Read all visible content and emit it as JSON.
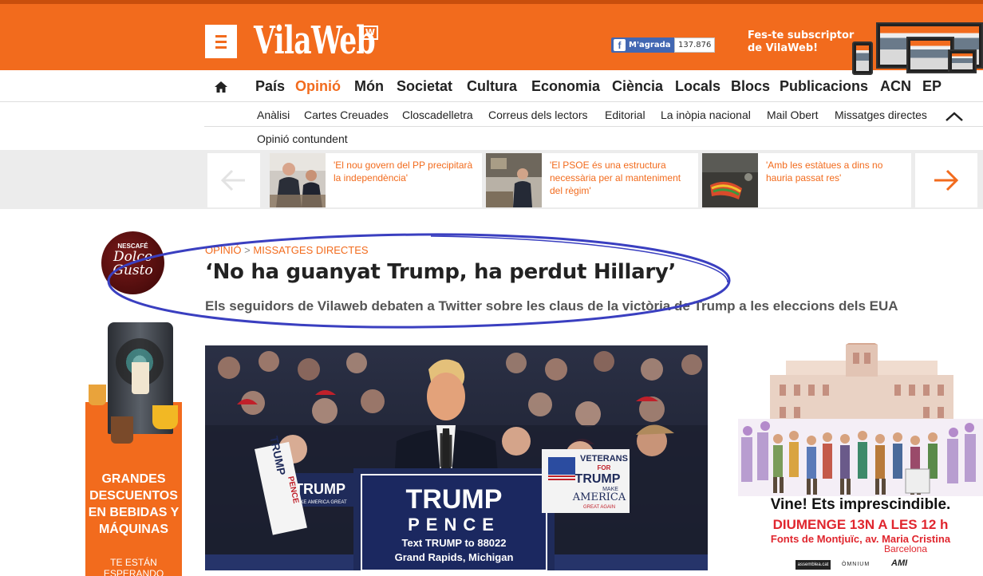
{
  "header": {
    "logo_text": "VilaWeb",
    "logo_badge": "W",
    "fb_like_label": "M'agrada",
    "fb_count": "137.876",
    "subscribe_line1": "Fes-te subscriptor",
    "subscribe_line2": "de VilaWeb!"
  },
  "main_nav": [
    "País",
    "Opinió",
    "Món",
    "Societat",
    "Cultura",
    "Economia",
    "Ciència",
    "Locals",
    "Blocs",
    "Publicacions",
    "ACN",
    "EP"
  ],
  "sub_nav": [
    "Anàlisi",
    "Cartes Creuades",
    "Closcadelletra",
    "Correus dels lectors",
    "Editorial",
    "La inòpia nacional",
    "Mail Obert",
    "Missatges directes",
    "Opinió contundent"
  ],
  "carousel": [
    {
      "text": "'El nou govern del PP precipitarà la independència'"
    },
    {
      "text": "'El PSOE és una estructura necessària per al manteniment del règim'"
    },
    {
      "text": "'Amb les estàtues a dins no hauria passat res'"
    }
  ],
  "article": {
    "breadcrumb_section": "OPINIÓ",
    "breadcrumb_sep": ">",
    "breadcrumb_sub": "MISSATGES DIRECTES",
    "headline": "‘No ha guanyat Trump, ha perdut Hillary’",
    "subtitle": "Els seguidors de Vilaweb debaten a Twitter sobre les claus de la victòria de Trump a les eleccions dels EUA"
  },
  "sponsor": {
    "brand": "NESCAFÉ",
    "name_line1": "Dolce",
    "name_line2": "Gusto"
  },
  "ad_left": {
    "headline": "GRANDES DESCUENTOS EN BEBIDAS Y MÁQUINAS",
    "footer": "TE ESTÁN ESPERANDO"
  },
  "photo": {
    "sign_main_line1": "TRUMP",
    "sign_main_line2": "PENCE",
    "sign_main_line3": "Text TRUMP to 88022",
    "sign_main_line4": "Grand Rapids, Michigan",
    "sign_left_word": "TRUMP",
    "sign_left_sub": "MAKE AMERICA GREAT",
    "sign_vertical_1": "TRUMP",
    "sign_vertical_2": "PENCE",
    "sign_veterans_1": "VETERANS",
    "sign_veterans_2": "FOR",
    "sign_veterans_3": "TRUMP",
    "sign_veterans_4": "MAKE",
    "sign_veterans_5": "AMERICA",
    "sign_veterans_6": "GREAT AGAIN"
  },
  "ad_right": {
    "slogan": "Vine! Ets imprescindible.",
    "date_line": "DIUMENGE 13N A LES 12 h",
    "place_line": "Fonts de Montjuïc, av. Maria Cristina",
    "city": "Barcelona",
    "logo1": "assemblea.cat",
    "logo2": "ÒMNIUM",
    "logo3": "AMI"
  },
  "colors": {
    "brand_orange": "#f26b1d",
    "annotation_blue": "#3a3fc0",
    "facebook_blue": "#4267b2"
  }
}
